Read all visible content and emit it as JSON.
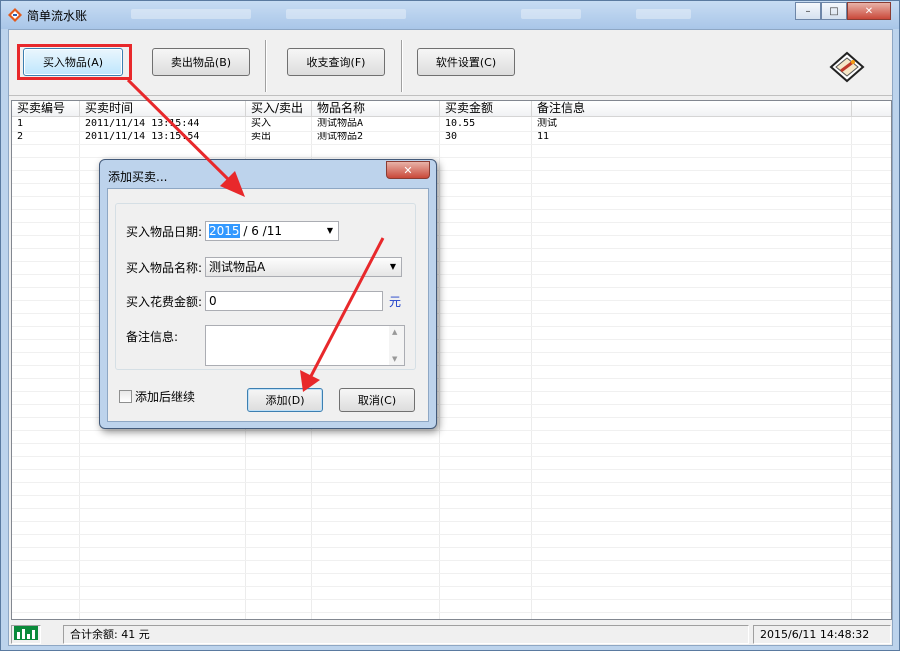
{
  "window": {
    "title": "简单流水账",
    "minimize": "–",
    "maximize": "□",
    "close": "✕"
  },
  "toolbar": {
    "buy_label": "买入物品(A)",
    "sell_label": "卖出物品(B)",
    "query_label": "收支查询(F)",
    "settings_label": "软件设置(C)"
  },
  "list": {
    "columns": [
      "买卖编号",
      "买卖时间",
      "买入/卖出",
      "物品名称",
      "买卖金额",
      "备注信息"
    ],
    "rows": [
      [
        "1",
        "2011/11/14 13:15:44",
        "买入",
        "测试物品A",
        "10.55",
        "测试"
      ],
      [
        "2",
        "2011/11/14 13:15:54",
        "卖出",
        "测试物品2",
        "30",
        "11"
      ]
    ]
  },
  "status": {
    "total": "合计余额: 41 元",
    "datetime": "2015/6/11 14:48:32"
  },
  "dialog": {
    "title": "添加买卖...",
    "close": "✕",
    "date_label": "买入物品日期:",
    "date_year": "2015",
    "date_rest": "/ 6 /11",
    "name_label": "买入物品名称:",
    "name_value": "测试物品A",
    "amount_label": "买入花费金额:",
    "amount_value": "0",
    "unit": "元",
    "note_label": "备注信息:",
    "continue_label": "添加后继续",
    "add_label": "添加(D)",
    "cancel_label": "取消(C)"
  },
  "colors": {
    "annotation_red": "#e8282b",
    "unit_blue": "#1a3cc8"
  }
}
